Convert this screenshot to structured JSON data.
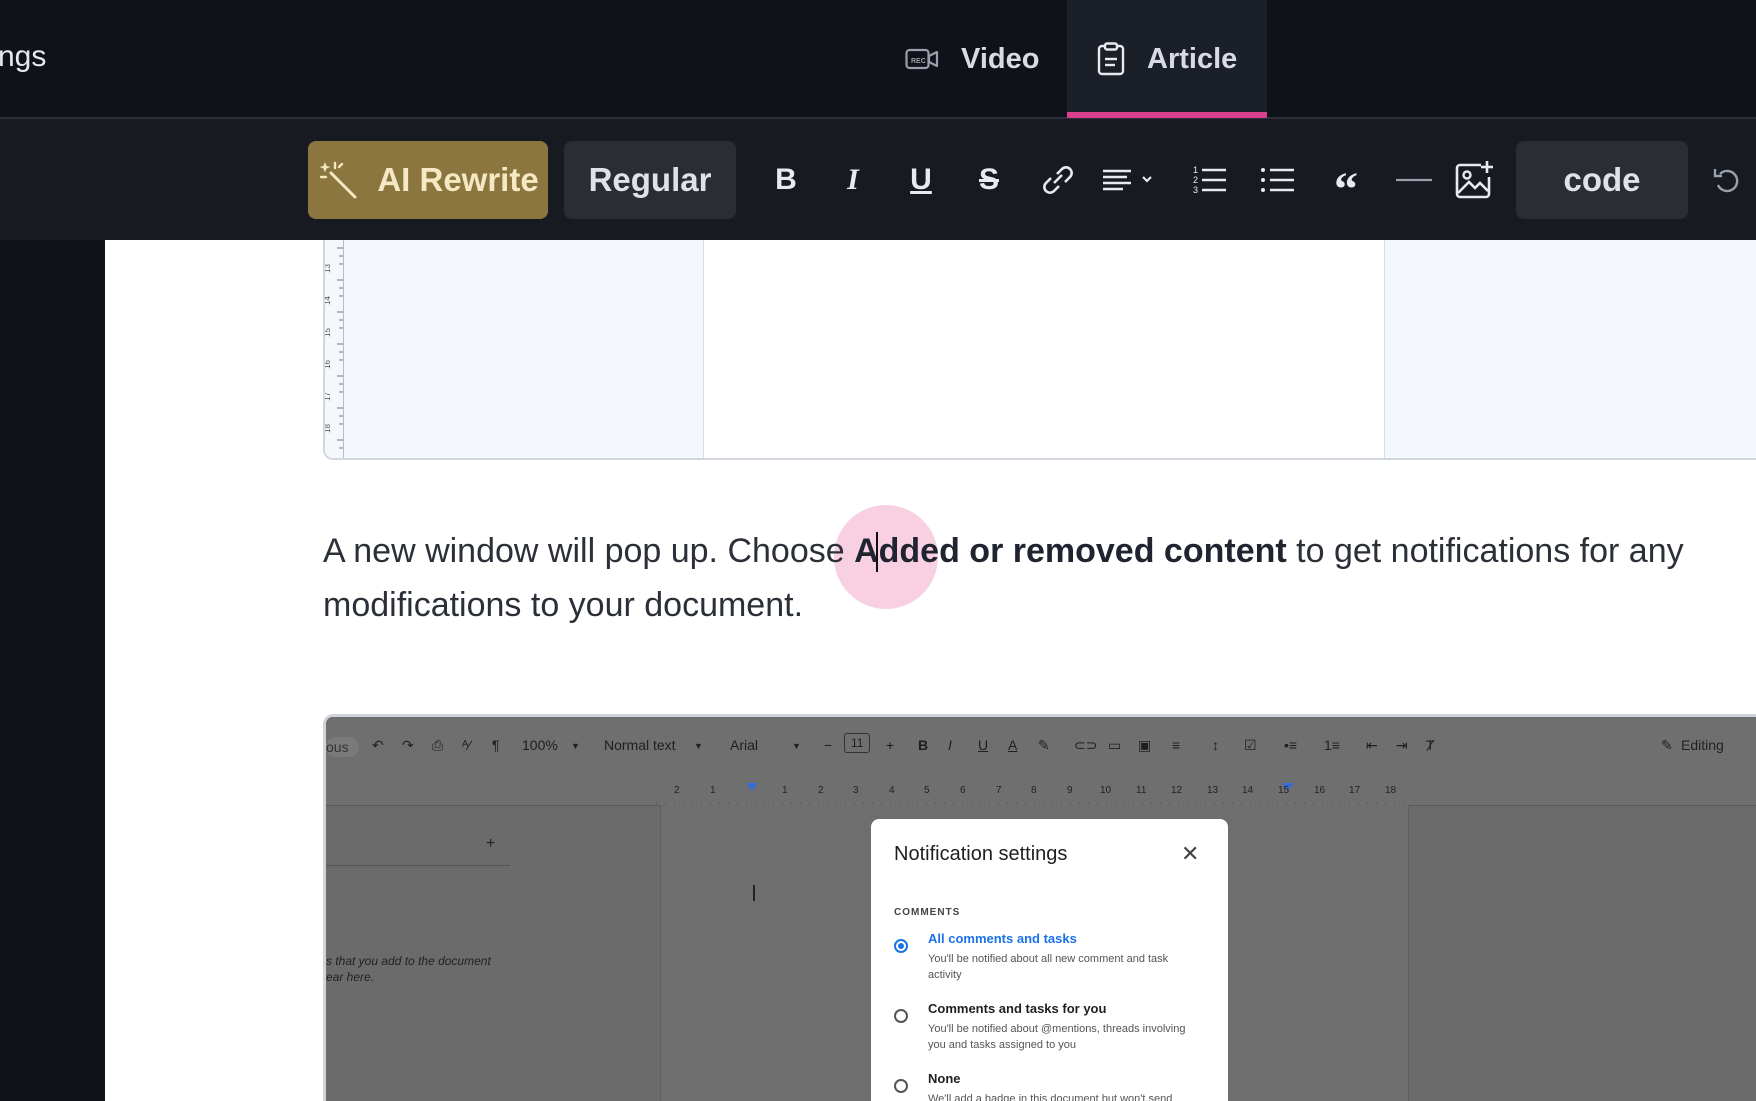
{
  "topbar": {
    "breadcrumb_partial": "ngs",
    "tabs": [
      {
        "label": "Video",
        "icon": "video-camera-icon",
        "active": false
      },
      {
        "label": "Article",
        "icon": "document-icon",
        "active": true
      }
    ],
    "accent_color": "#d8408e"
  },
  "toolbar": {
    "ai_rewrite": "AI Rewrite",
    "text_style": "Regular",
    "code_label": "code",
    "icons": [
      "bold-icon",
      "italic-icon",
      "underline-icon",
      "strikethrough-icon",
      "link-icon",
      "align-icon",
      "ordered-list-icon",
      "bullet-list-icon",
      "blockquote-icon",
      "divider-icon",
      "add-image-icon",
      "undo-icon"
    ],
    "bold": "B",
    "italic": "I",
    "underline": "U",
    "strike": "S",
    "quote": "“"
  },
  "article": {
    "para_before": "A new window will pop up. Choose",
    "para_bold": "Added or removed content",
    "para_after": " to get notifications for any",
    "para_line2": "modifications to your document."
  },
  "ruler_marks": [
    "13",
    "14",
    "15",
    "16",
    "17",
    "18"
  ],
  "screenshot": {
    "toolbar": {
      "partial": "ous",
      "zoom": "100%",
      "style": "Normal text",
      "font": "Arial",
      "font_size": "11",
      "minus": "−",
      "plus": "+",
      "editing": "Editing"
    },
    "ruler": [
      "2",
      "1",
      "1",
      "2",
      "3",
      "4",
      "5",
      "6",
      "7",
      "8",
      "9",
      "10",
      "11",
      "12",
      "13",
      "14",
      "15",
      "16",
      "17",
      "18"
    ],
    "comments_pane": {
      "plus": "+",
      "note": "s that you add to the document\near here."
    },
    "dialog": {
      "title": "Notification settings",
      "close": "✕",
      "section": "COMMENTS",
      "options": [
        {
          "label": "All comments and tasks",
          "desc": "You'll be notified about all new comment and task activity",
          "selected": true
        },
        {
          "label": "Comments and tasks for you",
          "desc": "You'll be notified about @mentions, threads involving you and tasks assigned to you",
          "selected": false
        },
        {
          "label": "None",
          "desc": "We'll add a badge in this document but won't send",
          "selected": false
        }
      ]
    }
  }
}
